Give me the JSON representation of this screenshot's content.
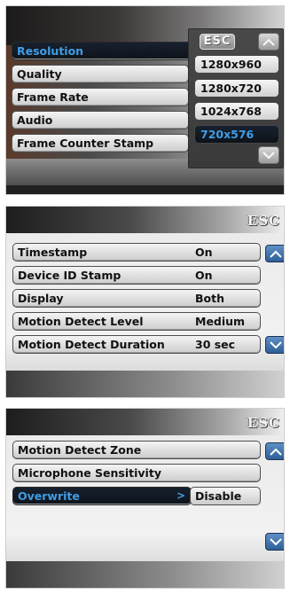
{
  "screen1": {
    "menu": [
      {
        "label": "Resolution",
        "selected": true
      },
      {
        "label": "Quality",
        "selected": false
      },
      {
        "label": "Frame Rate",
        "selected": false
      },
      {
        "label": "Audio",
        "selected": false
      },
      {
        "label": "Frame Counter Stamp",
        "selected": false
      }
    ],
    "esc_label": "ESC",
    "options": [
      {
        "label": "1280x960",
        "selected": false
      },
      {
        "label": "1280x720",
        "selected": false
      },
      {
        "label": "1024x768",
        "selected": false
      },
      {
        "label": "720x576",
        "selected": true
      }
    ],
    "arrow_icons": [
      "up-arrow-icon",
      "down-arrow-icon"
    ]
  },
  "screen2": {
    "esc_label": "ESC",
    "rows": [
      {
        "label": "Timestamp",
        "value": "On"
      },
      {
        "label": "Device ID Stamp",
        "value": "On"
      },
      {
        "label": "Display",
        "value": "Both"
      },
      {
        "label": "Motion Detect Level",
        "value": "Medium"
      },
      {
        "label": "Motion Detect Duration",
        "value": "30 sec"
      }
    ]
  },
  "screen3": {
    "esc_label": "ESC",
    "rows": [
      {
        "label": "Motion Detect Zone",
        "value": ""
      },
      {
        "label": "Microphone Sensitivity",
        "value": ""
      },
      {
        "label": "Overwrite",
        "value": "Disable",
        "selected": true
      }
    ]
  },
  "colors": {
    "selected_text": "#3f9de6",
    "arrow_button": "#3f74b0"
  }
}
